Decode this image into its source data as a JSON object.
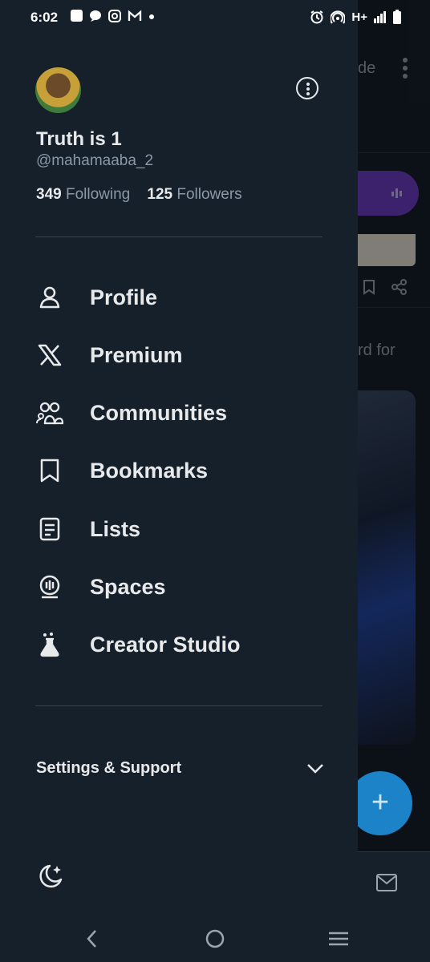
{
  "status_bar": {
    "time": "6:02",
    "network": "H+",
    "left_icons": [
      "facebook-icon",
      "chat-icon",
      "instagram-icon",
      "gmail-icon",
      "dot-icon"
    ],
    "right_icons": [
      "alarm-icon",
      "hotspot-icon",
      "signal-icon",
      "battery-icon"
    ]
  },
  "background": {
    "header_text": "de",
    "snippet_text": "rd for"
  },
  "profile": {
    "display_name": "Truth is 1",
    "handle": "@mahamaaba_2",
    "following_count": "349",
    "following_label": "Following",
    "followers_count": "125",
    "followers_label": "Followers"
  },
  "menu": {
    "items": [
      {
        "label": "Profile",
        "icon": "person-icon"
      },
      {
        "label": "Premium",
        "icon": "x-logo-icon"
      },
      {
        "label": "Communities",
        "icon": "communities-icon"
      },
      {
        "label": "Bookmarks",
        "icon": "bookmark-icon"
      },
      {
        "label": "Lists",
        "icon": "list-icon"
      },
      {
        "label": "Spaces",
        "icon": "spaces-icon"
      },
      {
        "label": "Creator Studio",
        "icon": "flask-icon"
      }
    ]
  },
  "settings": {
    "label": "Settings & Support"
  },
  "colors": {
    "drawer_bg": "#15202b",
    "text_primary": "#e7e9ea",
    "text_secondary": "#8b98a5",
    "accent_fab": "#1d83c9"
  }
}
